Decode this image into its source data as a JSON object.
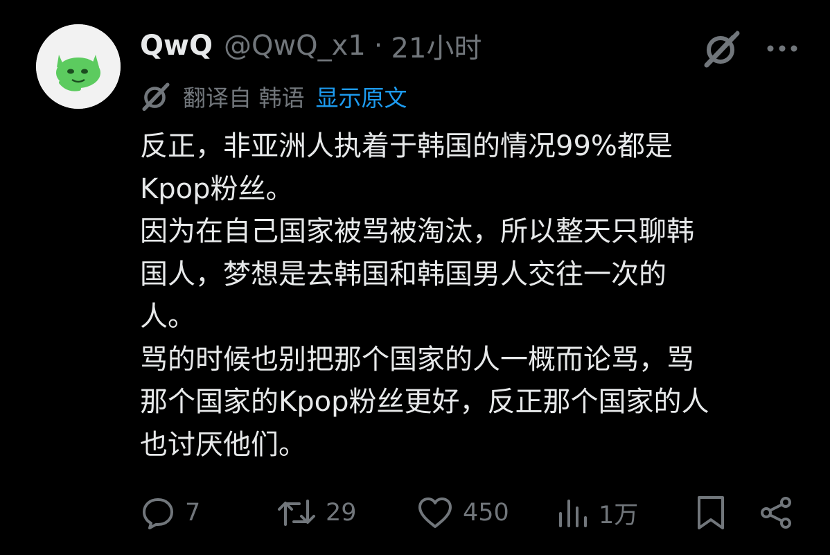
{
  "post": {
    "display_name": "QwQ",
    "handle": "@QwQ_x1",
    "separator": "·",
    "time": "21小时",
    "translation": {
      "label": "翻译自 韩语",
      "show_original": "显示原文"
    },
    "body_lines": [
      "反正，非亚洲人执着于韩国的情况99%都是",
      "Kpop粉丝。",
      "因为在自己国家被骂被淘汰，所以整天只聊韩",
      "国人，梦想是去韩国和韩国男人交往一次的",
      "人。",
      "骂的时候也别把那个国家的人一概而论骂，骂",
      "那个国家的Kpop粉丝更好，反正那个国家的人",
      "也讨厌他们。"
    ],
    "stats": {
      "replies": "7",
      "reposts": "29",
      "likes": "450",
      "views": "1万"
    }
  },
  "icons": {
    "avatar": "green-cat-avatar",
    "grok": "grok-icon",
    "more": "more-icon",
    "translate": "grok-translate-icon",
    "reply": "reply-icon",
    "repost": "repost-icon",
    "like": "heart-icon",
    "views": "analytics-icon",
    "bookmark": "bookmark-icon",
    "share": "share-icon"
  },
  "colors": {
    "background": "#000000",
    "text": "#e7e9ea",
    "muted": "#71767b",
    "link": "#1d9bf0",
    "avatar_green": "#5ccb5f"
  }
}
